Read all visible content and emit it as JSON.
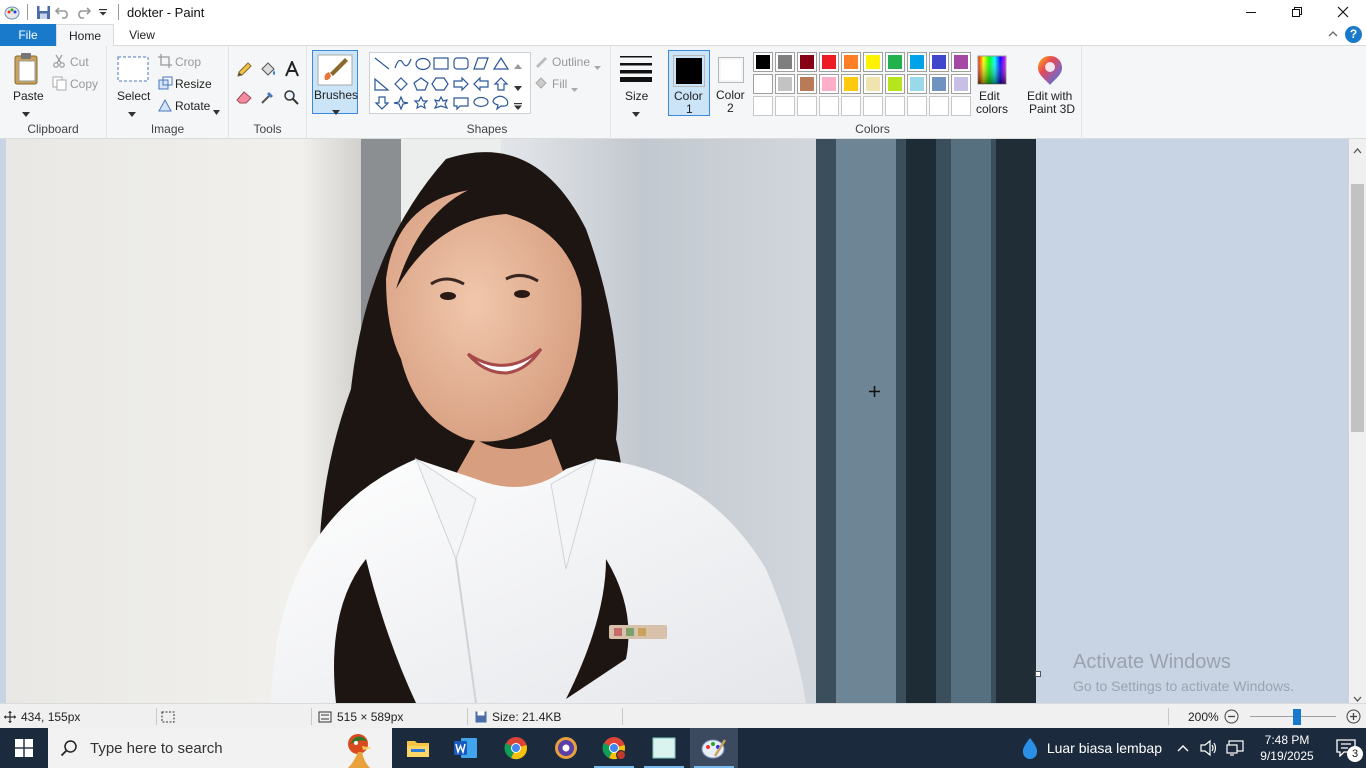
{
  "window": {
    "title": "dokter - Paint"
  },
  "tabs": [
    {
      "label": "File"
    },
    {
      "label": "Home"
    },
    {
      "label": "View"
    }
  ],
  "help_label": "?",
  "ribbon": {
    "clipboard": {
      "label": "Clipboard",
      "paste": "Paste",
      "cut": "Cut",
      "copy": "Copy"
    },
    "image": {
      "label": "Image",
      "select": "Select",
      "crop": "Crop",
      "resize": "Resize",
      "rotate": "Rotate"
    },
    "tools": {
      "label": "Tools"
    },
    "brushes": {
      "label": "Brushes"
    },
    "shapes": {
      "label": "Shapes",
      "outline": "Outline",
      "fill": "Fill"
    },
    "size": {
      "label": "Size"
    },
    "colors": {
      "label": "Colors",
      "color1_line1": "Color",
      "color1_line2": "1",
      "color2_line1": "Color",
      "color2_line2": "2",
      "edit_line1": "Edit",
      "edit_line2": "colors",
      "paint3d_line1": "Edit with",
      "paint3d_line2": "Paint 3D",
      "color1_value": "#000000",
      "color2_value": "#ffffff",
      "palette_row1": [
        "#000000",
        "#7f7f7f",
        "#880015",
        "#ed1c24",
        "#ff7f27",
        "#fff200",
        "#22b14c",
        "#00a2e8",
        "#3f48cc",
        "#a349a4"
      ],
      "palette_row2": [
        "#ffffff",
        "#c3c3c3",
        "#b97a57",
        "#ffaec9",
        "#ffc90e",
        "#efe4b0",
        "#b5e61d",
        "#99d9ea",
        "#7092be",
        "#c8bfe7"
      ]
    }
  },
  "watermark": {
    "line1": "Activate Windows",
    "line2": "Go to Settings to activate Windows."
  },
  "status": {
    "cursor_pos": "434, 155px",
    "image_size": "515 × 589px",
    "file_size": "Size: 21.4KB",
    "zoom": "200%"
  },
  "taskbar": {
    "search_placeholder": "Type here to search",
    "weather": "Luar biasa lembap",
    "time": "7:48 PM",
    "date": "9/19/2025",
    "notifications": "3"
  }
}
